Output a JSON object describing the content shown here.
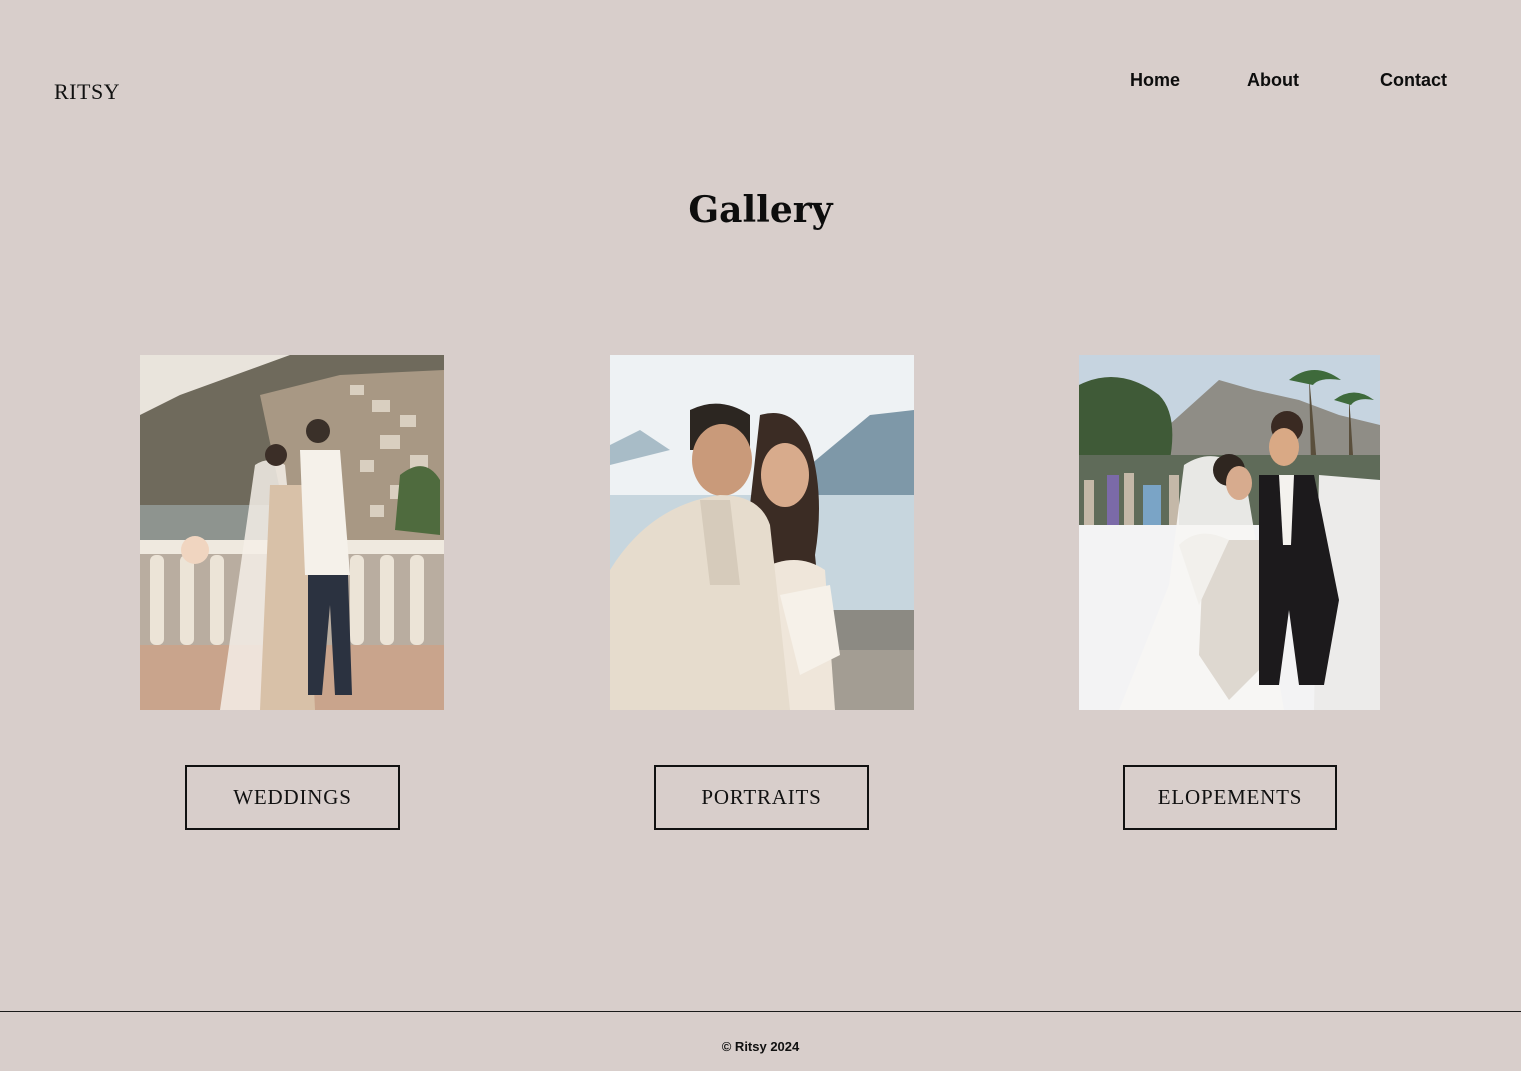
{
  "brand": {
    "logo_text": "RITSY"
  },
  "nav": {
    "home": "Home",
    "about": "About",
    "contact": "Contact"
  },
  "page": {
    "title": "Gallery"
  },
  "gallery": {
    "categories": [
      {
        "label": "WEDDINGS"
      },
      {
        "label": "PORTRAITS"
      },
      {
        "label": "ELOPEMENTS"
      }
    ]
  },
  "footer": {
    "copyright": "© Ritsy 2024"
  },
  "colors": {
    "background": "#d8cecb",
    "text": "#0d0d0d",
    "border": "#111111"
  }
}
